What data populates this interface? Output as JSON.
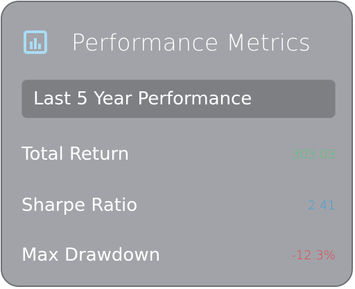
{
  "panel": {
    "title": "Performance Metrics",
    "icon": "bar-chart-icon",
    "period_label": "Last 5 Year Performance"
  },
  "metrics": [
    {
      "label": "Total Return",
      "value": "303.03",
      "color": "#4fc87a"
    },
    {
      "label": "Sharpe Ratio",
      "value": "2.41",
      "color": "#3aa0e0"
    },
    {
      "label": "Max Drawdown",
      "value": "-12.3%",
      "color": "#e0454f"
    }
  ],
  "colors": {
    "accent_icon": "#a9dcf5",
    "card_background": "#a2a3a8",
    "period_background": "#7e7f83"
  }
}
